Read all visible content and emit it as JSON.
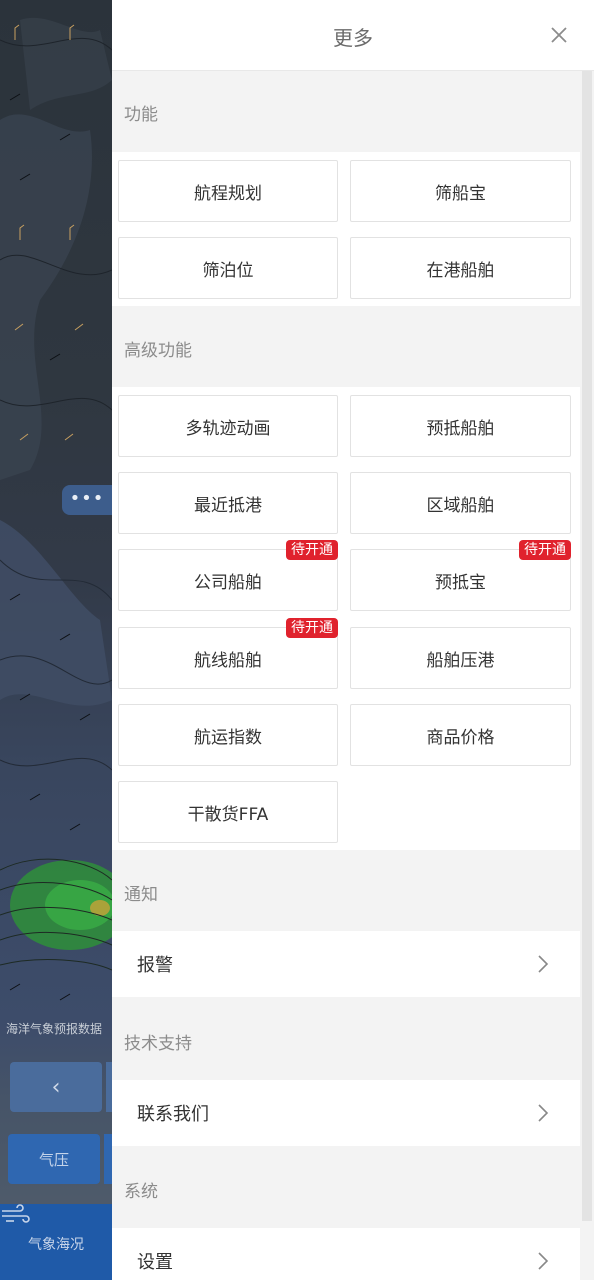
{
  "map": {
    "caption": "海洋气象预报数据",
    "prev_glyph": "‹",
    "pressure_button": "气压",
    "tab_label": "气象海况",
    "more_glyph": "•••"
  },
  "drawer": {
    "title": "更多",
    "sections": {
      "features": {
        "title": "功能",
        "items": [
          {
            "label": "航程规划"
          },
          {
            "label": "筛船宝"
          },
          {
            "label": "筛泊位"
          },
          {
            "label": "在港船舶"
          }
        ]
      },
      "advanced": {
        "title": "高级功能",
        "items": [
          {
            "label": "多轨迹动画"
          },
          {
            "label": "预抵船舶"
          },
          {
            "label": "最近抵港"
          },
          {
            "label": "区域船舶"
          },
          {
            "label": "公司船舶",
            "badge": "待开通"
          },
          {
            "label": "预抵宝",
            "badge": "待开通"
          },
          {
            "label": "航线船舶",
            "badge": "待开通"
          },
          {
            "label": "船舶压港"
          },
          {
            "label": "航运指数"
          },
          {
            "label": "商品价格"
          },
          {
            "label": "干散货FFA"
          }
        ]
      },
      "notice": {
        "title": "通知",
        "item": "报警"
      },
      "support": {
        "title": "技术支持",
        "item": "联系我们"
      },
      "system": {
        "title": "系统",
        "item": "设置"
      }
    }
  },
  "colors": {
    "badge": "#e0222d",
    "tab_bar": "#1f5aa8",
    "panel_bg": "#f3f3f3"
  }
}
